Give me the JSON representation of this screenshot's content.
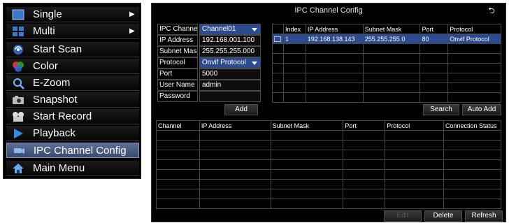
{
  "menu": {
    "items": [
      {
        "label": "Single",
        "icon": "single-view-icon",
        "arrow": "▶"
      },
      {
        "label": "Multi",
        "icon": "multi-view-icon",
        "arrow": "▶"
      },
      {
        "label": "Start Scan",
        "icon": "scan-icon",
        "arrow": ""
      },
      {
        "label": "Color",
        "icon": "color-icon",
        "arrow": ""
      },
      {
        "label": "E-Zoom",
        "icon": "zoom-icon",
        "arrow": ""
      },
      {
        "label": "Snapshot",
        "icon": "camera-icon",
        "arrow": ""
      },
      {
        "label": "Start Record",
        "icon": "record-icon",
        "arrow": ""
      },
      {
        "label": "Playback",
        "icon": "play-icon",
        "arrow": ""
      },
      {
        "label": "IPC Channel Config",
        "icon": "ipc-camera-icon",
        "arrow": "",
        "selected": true
      },
      {
        "label": "Main Menu",
        "icon": "home-icon",
        "arrow": ""
      }
    ]
  },
  "dialog": {
    "title": "IPC Channel Config",
    "return_icon": "⮌",
    "form": {
      "ipc_channel": {
        "label": "IPC Channel",
        "value": "Channel01"
      },
      "ip_address": {
        "label": "IP Address",
        "value": "192.168.001.100"
      },
      "subnet_mask": {
        "label": "Subnet Mask",
        "value": "255.255.255.000"
      },
      "protocol": {
        "label": "Protocol",
        "value": "Onvif Protocol"
      },
      "port": {
        "label": "Port",
        "value": "5000"
      },
      "user_name": {
        "label": "User Name",
        "value": "admin"
      },
      "password": {
        "label": "Password",
        "value": ""
      }
    },
    "add_label": "Add",
    "search_label": "Search",
    "auto_add_label": "Auto Add",
    "search_table": {
      "headers": [
        "",
        "Index",
        "IP Address",
        "Subnet Mask",
        "Port",
        "Protocol"
      ],
      "rows": [
        {
          "index": "1",
          "ip": "192.168.138.143",
          "mask": "255.255.255.0",
          "port": "80",
          "protocol": "Onvif Protocol"
        }
      ]
    },
    "channel_table": {
      "headers": [
        "Channel",
        "IP Address",
        "Subnet Mask",
        "Port",
        "Protocol",
        "Connection Status"
      ]
    },
    "edit_label": "Edit",
    "delete_label": "Delete",
    "refresh_label": "Refresh"
  },
  "colors": {
    "selection": "#2d4b90",
    "background": "#000000"
  }
}
